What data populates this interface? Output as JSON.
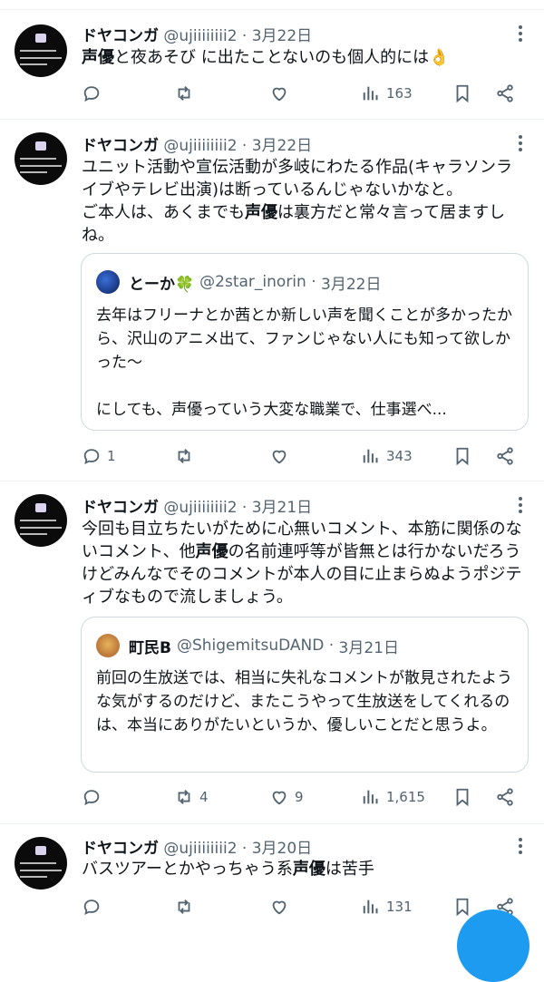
{
  "tweets": [
    {
      "name": "ドヤコンガ",
      "handle": "@ujiiiiiiii2",
      "date": "3月22日",
      "text_html": "<b>声優</b>と夜あそび に出たことないのも個人的には👌",
      "reply_count": "",
      "retweet_count": "",
      "like_count": "",
      "view_count": "163"
    },
    {
      "name": "ドヤコンガ",
      "handle": "@ujiiiiiiii2",
      "date": "3月22日",
      "text_html": "ユニット活動や宣伝活動が多岐にわたる作品(キャラソンライブやテレビ出演)は断っているんじゃないかなと。<br>ご本人は、あくまでも<b>声優</b>は裏方だと常々言って居ますしね。",
      "quote": {
        "name": "とーか🍀",
        "handle": "@2star_inorin",
        "date": "3月22日",
        "text_html": "去年はフリーナとか茜とか新しい声を聞くことが多かったから、沢山のアニメ出て、ファンじゃない人にも知って欲しかった〜<br><br>にしても、声優っていう大変な職業で、仕事選べ..."
      },
      "reply_count": "1",
      "retweet_count": "",
      "like_count": "",
      "view_count": "343"
    },
    {
      "name": "ドヤコンガ",
      "handle": "@ujiiiiiiii2",
      "date": "3月21日",
      "text_html": "今回も目立ちたいがために心無いコメント、本筋に関係のないコメント、他<b>声優</b>の名前連呼等が皆無とは行かないだろうけどみんなでそのコメントが本人の目に止まらぬようポジティブなもので流しましょう。",
      "quote": {
        "name": "町民B",
        "handle": "@ShigemitsuDAND",
        "date": "3月21日",
        "text_html": "前回の生放送では、相当に失礼なコメントが散見されたような気がするのだけど、またこうやって生放送をしてくれるのは、本当にありがたいというか、優しいことだと思うよ。"
      },
      "reply_count": "",
      "retweet_count": "4",
      "like_count": "9",
      "view_count": "1,615"
    },
    {
      "name": "ドヤコンガ",
      "handle": "@ujiiiiiiii2",
      "date": "3月20日",
      "text_html": "バスツアーとかやっちゃう系<b>声優</b>は苦手",
      "reply_count": "",
      "retweet_count": "",
      "like_count": "",
      "view_count": "131"
    }
  ],
  "colors": {
    "accent": "#1d9bf0",
    "muted": "#536471",
    "border": "#eff3f4"
  }
}
